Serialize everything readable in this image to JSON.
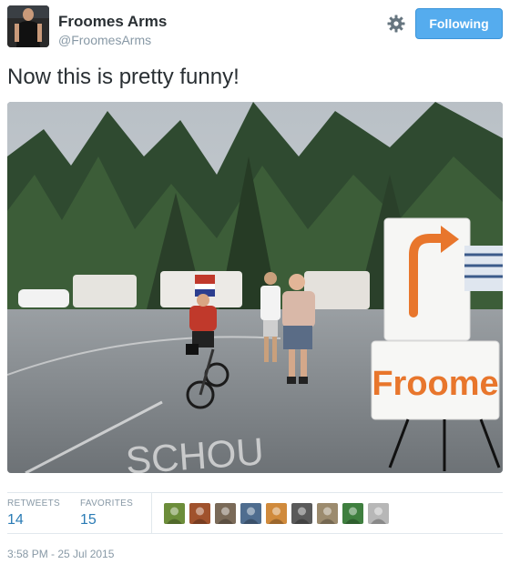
{
  "user": {
    "full_name": "Froomes Arms",
    "handle": "@FroomesArms",
    "follow_label": "Following"
  },
  "tweet": {
    "text": "Now this is pretty funny!",
    "photo": {
      "road_text": "SCHOU",
      "sign_text": "Froome"
    }
  },
  "stats": {
    "retweets_label": "RETWEETS",
    "retweets_value": "14",
    "favorites_label": "FAVORITES",
    "favorites_value": "15"
  },
  "favoriters": [
    {
      "color": "#6c8d3a"
    },
    {
      "color": "#a0522d"
    },
    {
      "color": "#7a6a58"
    },
    {
      "color": "#4f6d8f"
    },
    {
      "color": "#d08a3c"
    },
    {
      "color": "#5a5a5a"
    },
    {
      "color": "#9c8b6e"
    },
    {
      "color": "#3f7f3f"
    },
    {
      "color": "#b7b7b7"
    }
  ],
  "timestamp": "3:58 PM - 25 Jul 2015",
  "colors": {
    "accent": "#55acee",
    "link": "#2a7bb5",
    "muted": "#8899a6",
    "sign_orange": "#e8762c"
  }
}
